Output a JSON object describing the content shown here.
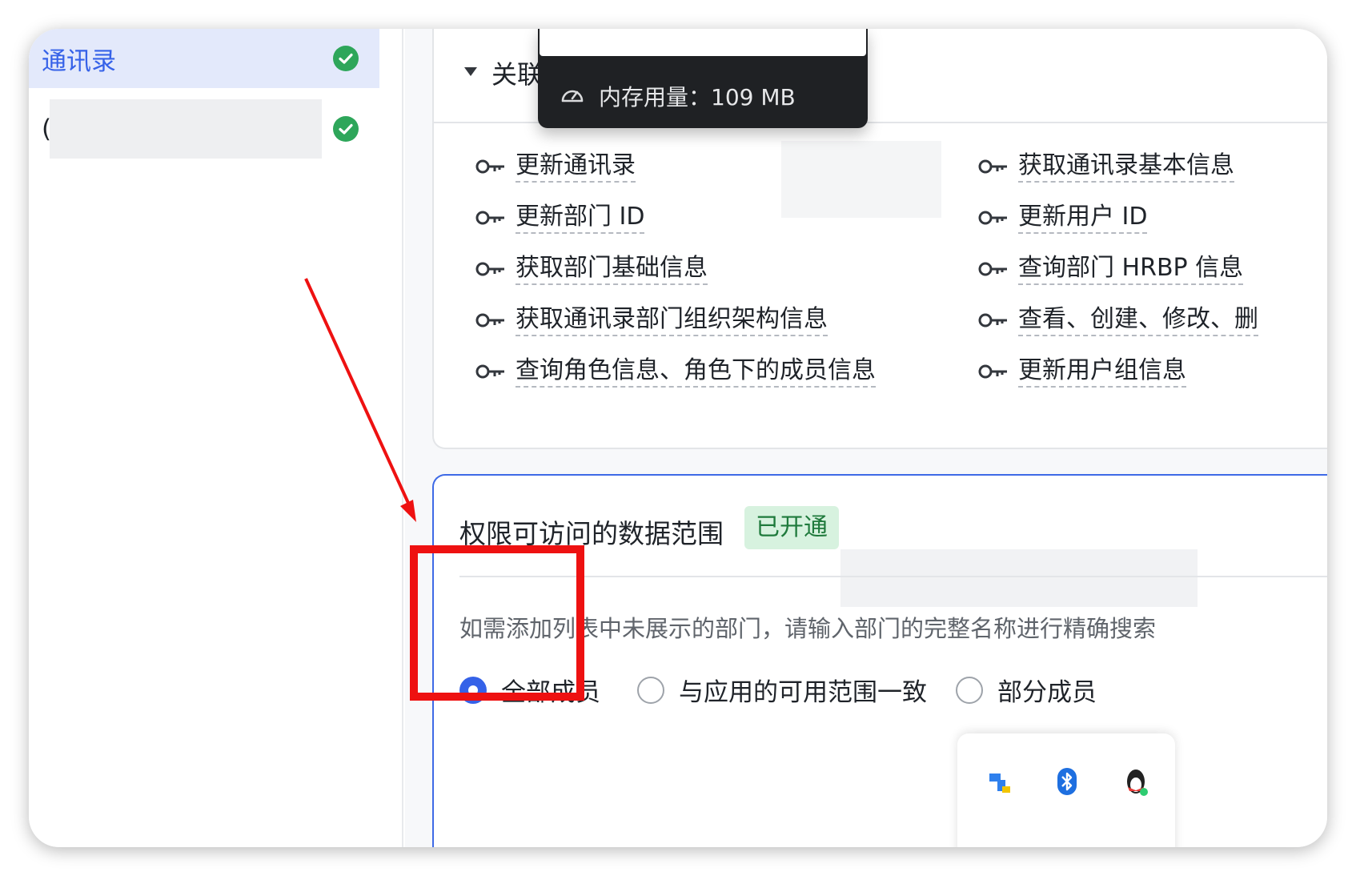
{
  "sidebar": {
    "items": [
      {
        "label": "通讯录",
        "status": "ok"
      },
      {
        "label": "(",
        "status": "ok"
      }
    ]
  },
  "memory_tip": {
    "text": "内存用量：109 MB"
  },
  "scopes_card": {
    "title": "关联的",
    "permissions_left": [
      "更新通讯录",
      "更新部门 ID",
      "获取部门基础信息",
      "获取通讯录部门组织架构信息",
      "查询角色信息、角色下的成员信息"
    ],
    "permissions_right": [
      "获取通讯录基本信息",
      "更新用户 ID",
      "查询部门 HRBP 信息",
      "查看、创建、修改、删",
      "更新用户组信息"
    ]
  },
  "data_scope": {
    "title": "权限可访问的数据范围",
    "badge": "已开通",
    "hint": "如需添加列表中未展示的部门，请输入部门的完整名称进行精确搜索",
    "options": [
      {
        "label": "全部成员",
        "selected": true
      },
      {
        "label": "与应用的可用范围一致",
        "selected": false
      },
      {
        "label": "部分成员",
        "selected": false
      }
    ]
  },
  "colors": {
    "accent": "#3562e8",
    "success": "#2ea65a",
    "annotation": "#ee1111"
  },
  "tray": {
    "icons": [
      "app-icon",
      "bluetooth-icon",
      "qq-penguin-icon"
    ]
  }
}
